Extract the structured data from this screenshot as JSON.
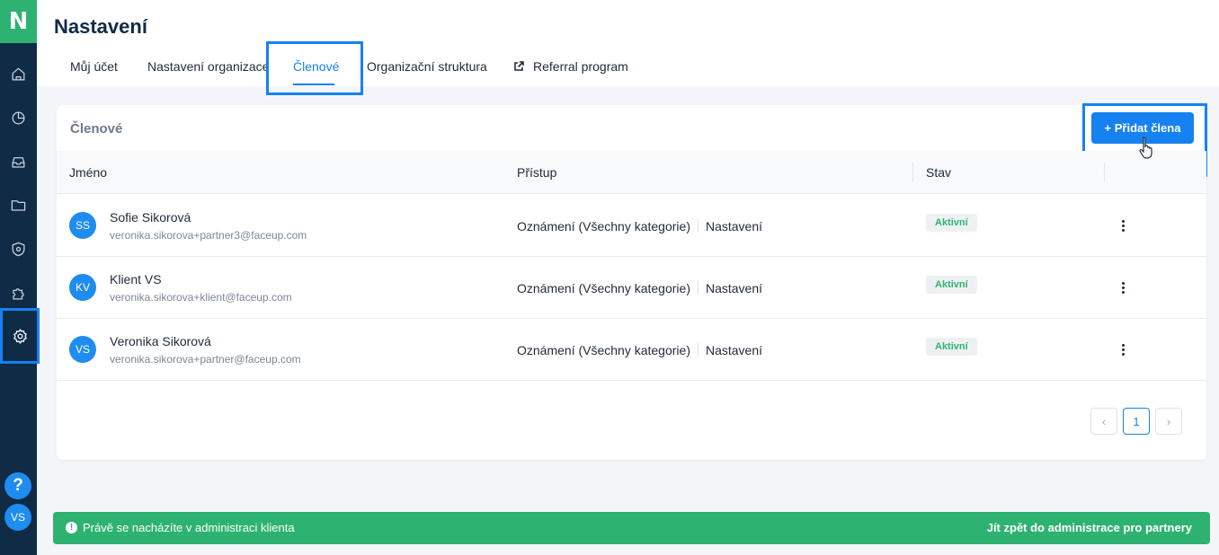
{
  "logo": "N",
  "sidebar": {
    "icons": [
      "home-icon",
      "pie-chart-icon",
      "inbox-icon",
      "folder-icon",
      "shield-gear-icon",
      "puzzle-icon",
      "settings-icon"
    ],
    "active": "settings-icon",
    "help": "?",
    "user_initials": "VS"
  },
  "header": {
    "title": "Nastavení",
    "tabs": [
      {
        "label": "Můj účet"
      },
      {
        "label": "Nastavení organizace"
      },
      {
        "label": "Členové"
      },
      {
        "label": "Organizační struktura"
      },
      {
        "label": "Referral program"
      }
    ],
    "active_tab": "Členové"
  },
  "members": {
    "title": "Členové",
    "add_button": "+ Přidat člena",
    "columns": [
      "Jméno",
      "Přístup",
      "Stav"
    ],
    "rows": [
      {
        "initials": "SS",
        "name": "Sofie Sikorová",
        "email": "veronika.sikorova+partner3@faceup.com",
        "access_a": "Oznámení (Všechny kategorie)",
        "access_b": "Nastavení",
        "status": "Aktivní"
      },
      {
        "initials": "KV",
        "name": "Klient VS",
        "email": "veronika.sikorova+klient@faceup.com",
        "access_a": "Oznámení (Všechny kategorie)",
        "access_b": "Nastavení",
        "status": "Aktivní"
      },
      {
        "initials": "VS",
        "name": "Veronika Sikorová",
        "email": "veronika.sikorova+partner@faceup.com",
        "access_a": "Oznámení (Všechny kategorie)",
        "access_b": "Nastavení",
        "status": "Aktivní"
      }
    ],
    "pagination": {
      "prev": "‹",
      "current": "1",
      "next": "›"
    }
  },
  "banner": {
    "icon": "!",
    "text": "Právě se nacházíte v administraci klienta",
    "link": "Jít zpět do administrace pro partnery"
  },
  "colors": {
    "sidebar": "#0f2b46",
    "accent": "#1681f0",
    "success": "#2eb271"
  }
}
